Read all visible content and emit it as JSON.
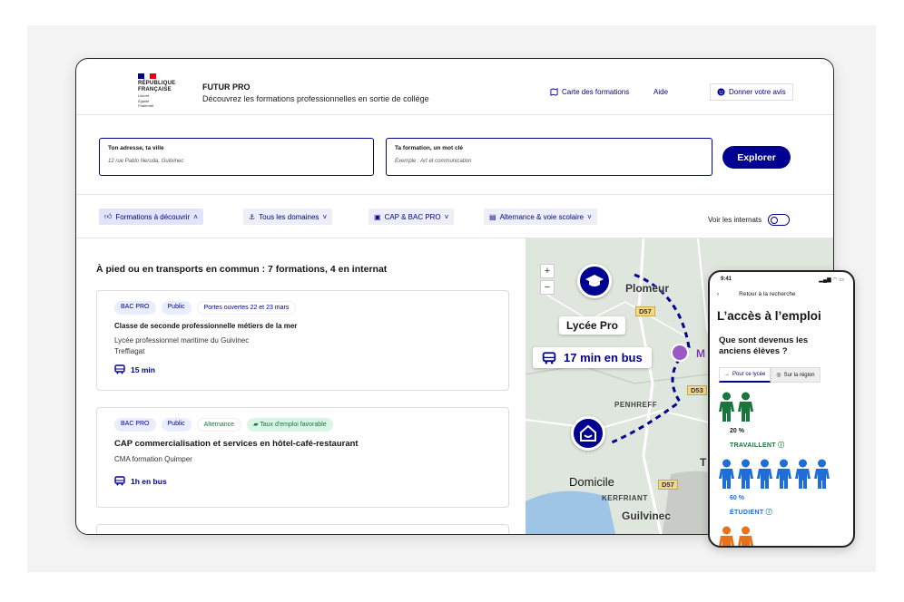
{
  "header": {
    "gov_line1": "RÉPUBLIQUE",
    "gov_line2": "FRANÇAISE",
    "motto1": "Liberté",
    "motto2": "Égalité",
    "motto3": "Fraternité",
    "site_title": "FUTUR PRO",
    "site_subtitle": "Découvrez les formations professionnelles en sortie de collège",
    "link_map": "Carte des formations",
    "link_help": "Aide",
    "link_feedback": "Donner votre avis"
  },
  "search": {
    "address_label": "Ton adresse, ta ville",
    "address_value": "12 rue  Pablo Neruda, Guilvinec",
    "formation_label": "Ta formation,  un mot clé",
    "formation_placeholder": "Exemple : Art et communication",
    "explore_label": "Explorer"
  },
  "filters": {
    "items": [
      "Formations à découvrir",
      "Tous les domaines",
      "CAP & BAC PRO",
      "Alternance & voie scolaire"
    ],
    "internats_label": "Voir les internats"
  },
  "results": {
    "heading": "À pied ou en transports en commun : 7 formations, 4 en internat",
    "cards": [
      {
        "tags": [
          "BAC PRO",
          "Public",
          "Portes ouvertes 22 et 23 mars"
        ],
        "title": "Classe de seconde professionnelle métiers de la mer",
        "school": "Lycée professionnel maritime du Guivinec",
        "city": "Treffiagat",
        "transport": "15 min"
      },
      {
        "tags": [
          "BAC PRO",
          "Public",
          "Alternance",
          "Taux d'emploi favorable"
        ],
        "title": "CAP commercialisation et services en hôtel-café-restaurant",
        "school": "CMA formation Quimper",
        "transport": "1h en bus"
      }
    ]
  },
  "map": {
    "zoom_in": "+",
    "zoom_out": "−",
    "school_label": "Lycée Pro",
    "home_label": "Domicile",
    "bus_label": "17 min en bus",
    "towns": [
      "Plomeur",
      "Guilvinec",
      "PENHREFF",
      "KERFRIANT",
      "M",
      "T"
    ],
    "roads": [
      "D57",
      "D53",
      "D57"
    ]
  },
  "phone": {
    "time": "9:41",
    "status": "▂▄▆ ◠ ▭",
    "back": "Retour  à la recherche",
    "title": "L’accès à l’emploi",
    "question": "Que sont devenus les anciens élèves ?",
    "tab1": "Pour ce lycée",
    "tab2": "Sur la région",
    "stat1_pct": "20 %",
    "stat1_label": "TRAVAILLENT",
    "stat2_pct": "60 %",
    "stat2_label": "ÉTUDIENT",
    "green": "#18753c",
    "blue": "#1e6dd8",
    "orange": "#e8711c"
  },
  "colors": {
    "accent": "#000091"
  }
}
